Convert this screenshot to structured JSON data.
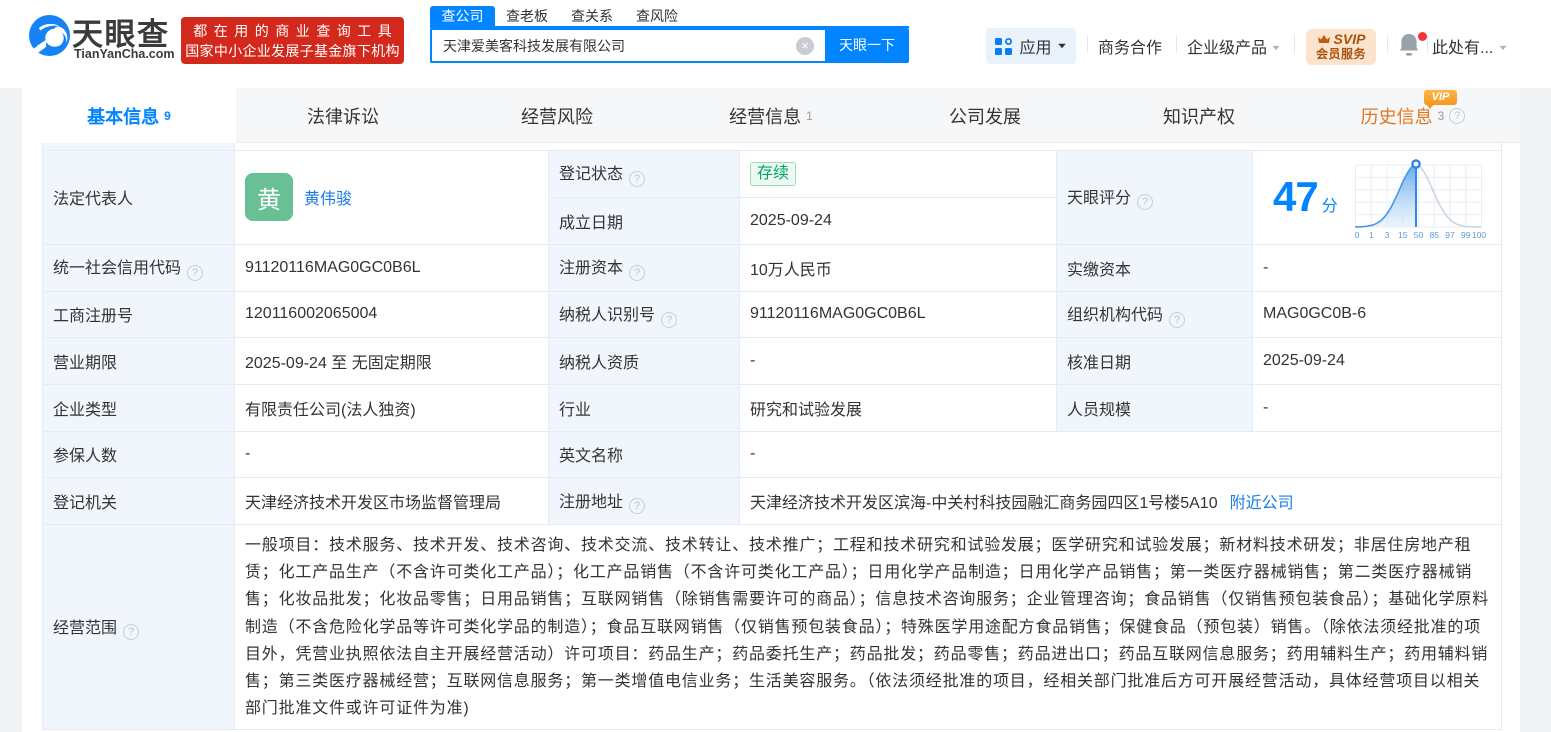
{
  "header": {
    "logo": {
      "title": "天眼查",
      "domain": "TianYanCha.com"
    },
    "slogan": {
      "line1": "都在用的商业查询工具",
      "line2": "国家中小企业发展子基金旗下机构"
    },
    "search": {
      "tabs": [
        "查公司",
        "查老板",
        "查关系",
        "查风险"
      ],
      "active_tab": "查公司",
      "value": "天津爱美客科技发展有限公司",
      "clear_icon": "×",
      "button": "天眼一下"
    },
    "menu": {
      "apps": "应用",
      "cooperation": "商务合作",
      "enterprise": "企业级产品",
      "svip_line1": "SVIP",
      "svip_line2": "会员服务",
      "user": "此处有..."
    }
  },
  "nav": {
    "tabs": [
      {
        "label": "基本信息",
        "count": "9",
        "active": true
      },
      {
        "label": "法律诉讼",
        "count": ""
      },
      {
        "label": "经营风险",
        "count": ""
      },
      {
        "label": "经营信息",
        "count": "1"
      },
      {
        "label": "公司发展",
        "count": ""
      },
      {
        "label": "知识产权",
        "count": ""
      },
      {
        "label": "历史信息",
        "count": "3",
        "vip": "VIP",
        "help": true
      }
    ]
  },
  "info": {
    "legal_rep": {
      "label": "法定代表人",
      "avatar": "黄",
      "name": "黄伟骏"
    },
    "reg_status": {
      "label": "登记状态",
      "value": "存续"
    },
    "est_date": {
      "label": "成立日期",
      "value": "2025-09-24"
    },
    "score": {
      "label": "天眼评分",
      "value": "47",
      "unit": "分"
    },
    "credit_code": {
      "label": "统一社会信用代码",
      "value": "91120116MAG0GC0B6L"
    },
    "reg_capital": {
      "label": "注册资本",
      "value": "10万人民币"
    },
    "paid_capital": {
      "label": "实缴资本",
      "value": "-"
    },
    "reg_number": {
      "label": "工商注册号",
      "value": "120116002065004"
    },
    "taxpayer_id": {
      "label": "纳税人识别号",
      "value": "91120116MAG0GC0B6L"
    },
    "org_code": {
      "label": "组织机构代码",
      "value": "MAG0GC0B-6"
    },
    "business_term": {
      "label": "营业期限",
      "value": "2025-09-24 至 无固定期限"
    },
    "taxpayer_quality": {
      "label": "纳税人资质",
      "value": "-"
    },
    "approval_date": {
      "label": "核准日期",
      "value": "2025-09-24"
    },
    "company_type": {
      "label": "企业类型",
      "value": "有限责任公司(法人独资)"
    },
    "industry": {
      "label": "行业",
      "value": "研究和试验发展"
    },
    "staff_size": {
      "label": "人员规模",
      "value": "-"
    },
    "insured_count": {
      "label": "参保人数",
      "value": "-"
    },
    "english_name": {
      "label": "英文名称",
      "value": "-"
    },
    "reg_authority": {
      "label": "登记机关",
      "value": "天津经济技术开发区市场监督管理局"
    },
    "reg_address": {
      "label": "注册地址",
      "value": "天津经济技术开发区滨海-中关村科技园融汇商务园四区1号楼5A10",
      "link": "附近公司"
    },
    "business_scope": {
      "label": "经营范围",
      "value": "一般项目：技术服务、技术开发、技术咨询、技术交流、技术转让、技术推广；工程和技术研究和试验发展；医学研究和试验发展；新材料技术研发；非居住房地产租赁；化工产品生产（不含许可类化工产品）；化工产品销售（不含许可类化工产品）；日用化学产品制造；日用化学产品销售；第一类医疗器械销售；第二类医疗器械销售；化妆品批发；化妆品零售；日用品销售；互联网销售（除销售需要许可的商品）；信息技术咨询服务；企业管理咨询；食品销售（仅销售预包装食品）；基础化学原料制造（不含危险化学品等许可类化学品的制造）；食品互联网销售（仅销售预包装食品）；特殊医学用途配方食品销售；保健食品（预包装）销售。（除依法须经批准的项目外，凭营业执照依法自主开展经营活动）许可项目：药品生产；药品委托生产；药品批发；药品零售；药品进出口；药品互联网信息服务；药用辅料生产；药用辅料销售；第三类医疗器械经营；互联网信息服务；第一类增值电信业务；生活美容服务。（依法须经批准的项目，经相关部门批准后方可开展经营活动，具体经营项目以相关部门批准文件或许可证件为准)"
    }
  },
  "score_chart": {
    "type": "area",
    "title": "天眼评分分布曲线",
    "score": 47,
    "x_ticks": [
      "0",
      "1",
      "3",
      "15",
      "50",
      "85",
      "97",
      "99",
      "100"
    ],
    "marker_color": "#2f86e8",
    "curve_color": "#4a97e8"
  },
  "colors": {
    "brand_blue": "#0084ff",
    "link_blue": "#1b7ce4",
    "red_badge": "#d3291d",
    "green_status": "#00a664",
    "avatar_green": "#69c095",
    "history_orange": "#e2761f",
    "label_bg": "#f0f6fb"
  }
}
